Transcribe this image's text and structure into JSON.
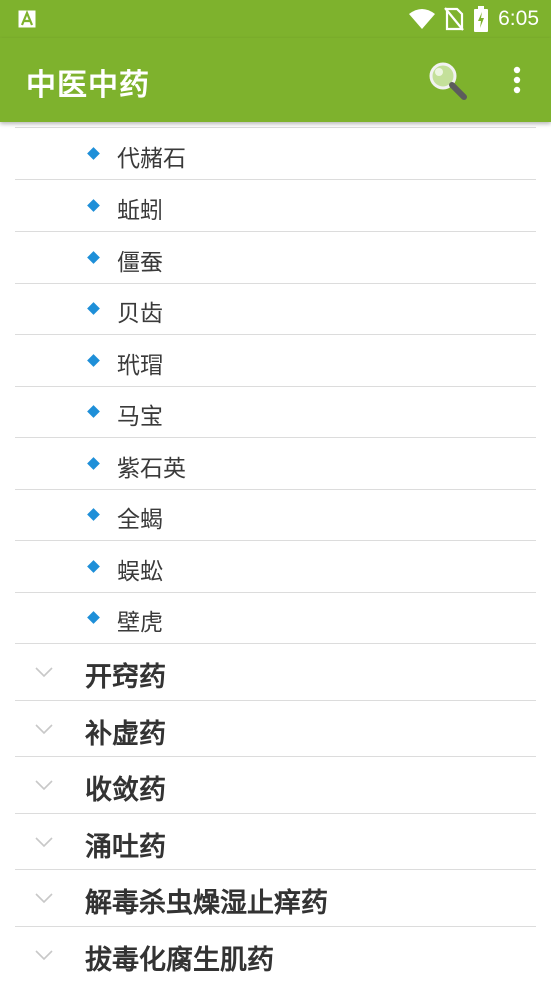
{
  "status_bar": {
    "time": "6:05"
  },
  "app_bar": {
    "title": "中医中药"
  },
  "colors": {
    "accent": "#7eb22d",
    "bullet": "#1e8fd8"
  },
  "children": [
    {
      "label": "代赭石"
    },
    {
      "label": "蚯蚓"
    },
    {
      "label": "僵蚕"
    },
    {
      "label": "贝齿"
    },
    {
      "label": "玳瑁"
    },
    {
      "label": "马宝"
    },
    {
      "label": "紫石英"
    },
    {
      "label": "全蝎"
    },
    {
      "label": "蜈蚣"
    },
    {
      "label": "壁虎"
    }
  ],
  "groups": [
    {
      "label": "开窍药"
    },
    {
      "label": "补虚药"
    },
    {
      "label": "收敛药"
    },
    {
      "label": "涌吐药"
    },
    {
      "label": "解毒杀虫燥湿止痒药"
    },
    {
      "label": "拔毒化腐生肌药"
    }
  ]
}
